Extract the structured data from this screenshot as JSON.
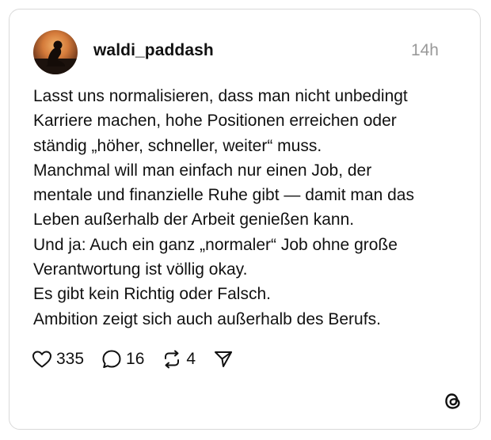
{
  "post": {
    "username": "waldi_paddash",
    "time": "14h",
    "lines": [
      "Lasst uns normalisieren, dass man nicht unbedingt",
      "Karriere machen, hohe Positionen erreichen oder",
      "ständig „höher, schneller, weiter“ muss.",
      "Manchmal will man einfach nur einen Job, der",
      "mentale und finanzielle Ruhe gibt — damit man das",
      "Leben außerhalb der Arbeit genießen kann.",
      "Und ja: Auch ein ganz „normaler“ Job ohne große",
      "Verantwortung ist völlig okay.",
      "Es gibt kein Richtig oder Falsch.",
      "Ambition zeigt sich auch außerhalb des Berufs."
    ]
  },
  "actions": {
    "likes": "335",
    "comments": "16",
    "reposts": "4"
  },
  "icons": {
    "like": "heart-icon",
    "comment": "comment-bubble-icon",
    "repost": "repost-icon",
    "share": "send-icon",
    "brand": "threads-logo-icon"
  }
}
